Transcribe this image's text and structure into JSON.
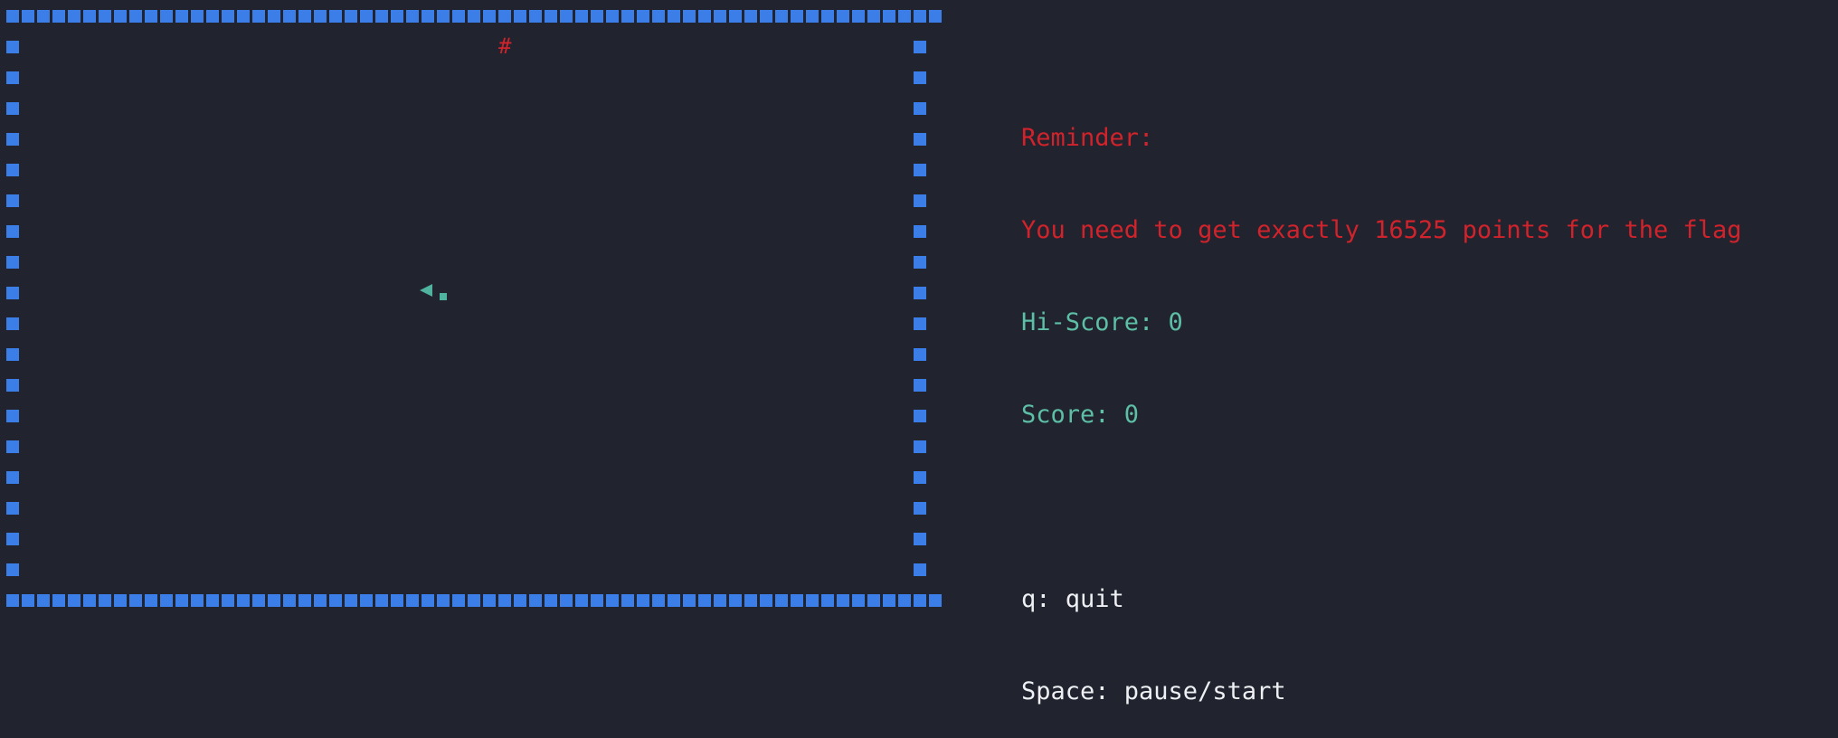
{
  "game": {
    "food_symbol": "#",
    "wall_color": "#3b7ee8",
    "snake_color": "#4fb3a0",
    "snake_direction": "left",
    "snake_length": 2
  },
  "panel": {
    "reminder_title": "Reminder:",
    "reminder_text": "You need to get exactly 16525 points for the flag",
    "hi_score": "Hi-Score: 0",
    "score": "Score: 0",
    "quit_hint": "q: quit",
    "pause_hint": "Space: pause/start"
  },
  "colors": {
    "background": "#21232e",
    "reminder": "#d1232b",
    "score": "#5cbfa6",
    "hint": "#eef0f4"
  }
}
